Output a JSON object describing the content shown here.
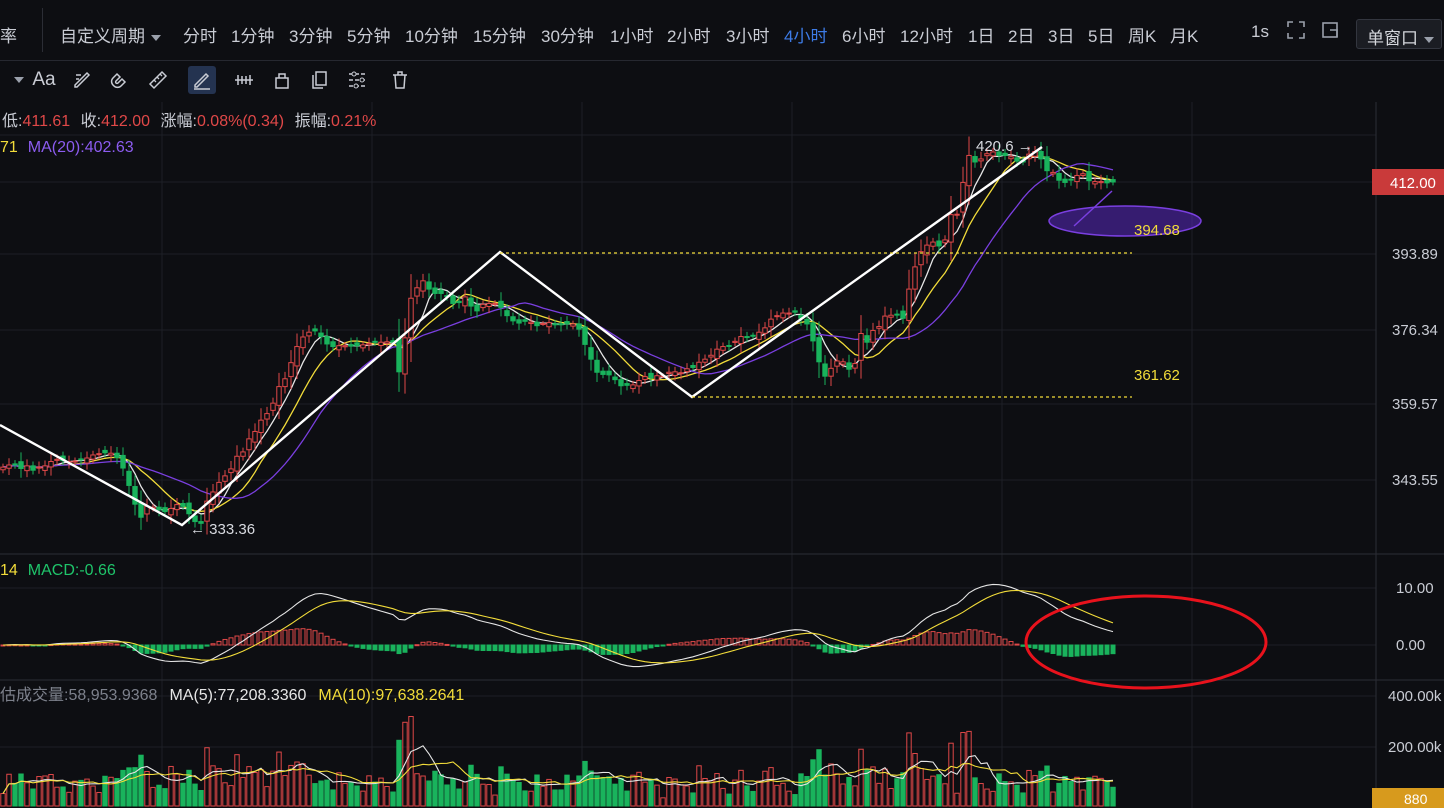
{
  "toolbar": {
    "left_text": "率",
    "custom_period": "自定义周期",
    "periods": [
      "分时",
      "1分钟",
      "3分钟",
      "5分钟",
      "10分钟",
      "15分钟",
      "30分钟",
      "1小时",
      "2小时",
      "3小时",
      "4小时",
      "6小时",
      "12小时",
      "1日",
      "2日",
      "3日",
      "5日",
      "周K",
      "月K"
    ],
    "active_period": "4小时",
    "refresh": "1s",
    "window_mode": "单窗口"
  },
  "drawing_tools": {
    "font_label": "Aa",
    "icons": [
      "caret-down-icon",
      "font-icon",
      "ruler-pencil-icon",
      "magnet-icon",
      "ruler-icon",
      "pencil-icon",
      "measure-icon",
      "lock-icon",
      "copy-icon",
      "settings-icon",
      "trash-icon"
    ],
    "active": "pencil-icon"
  },
  "info_line": {
    "low_label": "低:",
    "low": "411.61",
    "close_label": "收:",
    "close": "412.00",
    "change_label": "涨幅:",
    "change": "0.08%(0.34)",
    "amp_label": "振幅:",
    "amp": "0.21%",
    "ma_prefix": "71",
    "ma20": "MA(20):402.63"
  },
  "macd_line": {
    "prefix": "14",
    "macd": "MACD:-0.66"
  },
  "volume_line": {
    "label": "估成交量:58,953.9368",
    "ma5": "MA(5):77,208.3360",
    "ma10": "MA(10):97,638.2641"
  },
  "price_axis": [
    "412.00",
    "393.89",
    "376.34",
    "359.57",
    "343.55"
  ],
  "macd_axis": [
    "10.00",
    "0.00"
  ],
  "volume_axis": [
    "400.00k",
    "200.00k",
    "880"
  ],
  "annotations": {
    "high": "420.6 →",
    "low": "← 333.36",
    "level_a": "394.68",
    "level_b": "361.62"
  },
  "colors": {
    "up": "#e04848",
    "down": "#19b35c",
    "ma_white": "#e6e6e6",
    "ma_yellow": "#f2dc3a",
    "ma_purple": "#7a3fe0",
    "price_tag": "#c93a3a",
    "active_tab": "#3d7be6"
  },
  "chart_data": {
    "type": "candlestick",
    "timeframe": "4小时",
    "x": [
      0,
      1,
      2,
      3,
      4,
      5,
      6,
      7,
      8,
      9,
      10,
      11,
      12,
      13,
      14,
      15,
      16,
      17,
      18,
      19,
      20,
      21,
      22,
      23,
      24,
      25,
      26,
      27,
      28,
      29,
      30,
      31,
      32,
      33,
      34,
      35,
      36,
      37,
      38,
      39,
      40,
      41,
      42,
      43,
      44,
      45,
      46,
      47,
      48,
      49,
      50,
      51,
      52,
      53,
      54,
      55,
      56,
      57,
      58,
      59,
      60,
      61,
      62,
      63,
      64,
      65,
      66,
      67,
      68,
      69,
      70,
      71,
      72,
      73,
      74,
      75,
      76,
      77,
      78,
      79,
      80,
      81,
      82,
      83,
      84,
      85,
      86,
      87,
      88,
      89,
      90,
      91,
      92,
      93,
      94,
      95,
      96,
      97,
      98,
      99,
      100,
      101,
      102,
      103,
      104,
      105,
      106,
      107,
      108,
      109,
      110,
      111,
      112,
      113,
      114,
      115,
      116,
      117,
      118,
      119,
      120,
      121,
      122,
      123,
      124,
      125,
      126,
      127,
      128,
      129,
      130,
      131,
      132,
      133,
      134,
      135,
      136,
      137,
      138,
      139,
      140,
      141,
      142,
      143,
      144,
      145,
      146,
      147,
      148,
      149,
      150,
      151,
      152,
      153,
      154,
      155,
      156,
      157,
      158,
      159,
      160,
      161,
      162,
      163,
      164,
      165,
      166,
      167,
      168,
      169,
      170,
      171,
      172,
      173,
      174,
      175,
      176,
      177,
      178,
      179,
      180,
      181,
      182,
      183
    ],
    "close": [
      346.5,
      347,
      347,
      346.2,
      346.8,
      345.8,
      346.5,
      346.8,
      347.8,
      348.3,
      348,
      347.8,
      347.9,
      348.2,
      348.6,
      349.3,
      349.6,
      349.8,
      349.7,
      348.7,
      346.3,
      342.3,
      338,
      335,
      337.5,
      337.3,
      336.7,
      336.3,
      337,
      337.9,
      337.5,
      335.8,
      334,
      333.6,
      338.7,
      340.8,
      343,
      344.5,
      346.1,
      349,
      350,
      353,
      354.7,
      357.3,
      358.8,
      361.2,
      365,
      366.8,
      370.5,
      374.2,
      376.4,
      377.5,
      377.8,
      376.5,
      374.8,
      374.2,
      374.4,
      374.4,
      374.3,
      374.4,
      374.6,
      374.9,
      375.2,
      375.2,
      375.3,
      375.2,
      368.4,
      376.2,
      385.3,
      387.7,
      389.3,
      387.4,
      386.4,
      386.4,
      385.8,
      384.1,
      384.3,
      385.6,
      383.5,
      382.4,
      383.9,
      384.1,
      384.1,
      383.2,
      381.3,
      380.1,
      379.6,
      380,
      379.8,
      379,
      379.5,
      379.7,
      379.2,
      379.2,
      379.4,
      379.4,
      378.2,
      374.7,
      371.3,
      368.3,
      367.8,
      367.7,
      366.6,
      365.2,
      365.3,
      365.4,
      366.4,
      367.3,
      367,
      367.5,
      367.5,
      368.3,
      368.4,
      368.2,
      369.1,
      369.4,
      370.6,
      371.3,
      372.2,
      373.6,
      374.2,
      374.4,
      375.4,
      376.5,
      376.3,
      376.6,
      377.5,
      378.5,
      380.5,
      381.3,
      381.9,
      381.9,
      382.1,
      380.7,
      379.4,
      375.5,
      370.7,
      367.4,
      369.2,
      370.9,
      370.7,
      369,
      370.3,
      377.2,
      375.2,
      377.9,
      378.8,
      381.2,
      381.4,
      381.6,
      380.7,
      387.4,
      392.5,
      396,
      397.5,
      398.2,
      397.3,
      398.7,
      404.5,
      404.6,
      411.9,
      418.1,
      416.6,
      417.3,
      418.5,
      418.9,
      418.1,
      418.1,
      417.8,
      416.8,
      416.6,
      418.4,
      419,
      417.3,
      414.6,
      414.2,
      412.4,
      411.9,
      412.6,
      413.5,
      413.9,
      412.3,
      412.1,
      412.1,
      411.8,
      412
    ],
    "ma_white_last": 412.9,
    "ma_yellow_last": 412.7,
    "ma20_last": 402.63,
    "volume_ma5": 77208.336,
    "volume_ma10": 97638.2641,
    "macd_last": -0.66,
    "annotations": {
      "high": 420.6,
      "low": 333.36,
      "levels": [
        394.68,
        361.62
      ]
    }
  }
}
